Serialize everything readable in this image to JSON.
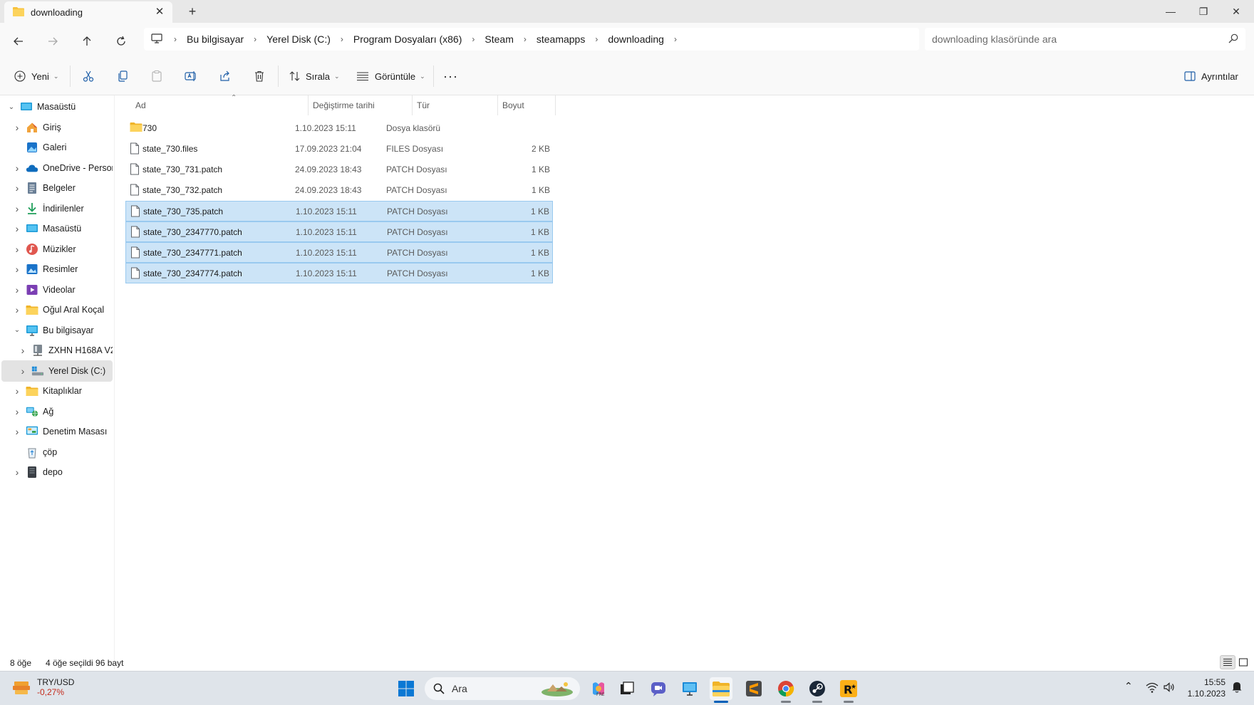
{
  "window": {
    "tab_title": "downloading",
    "new_tab": "+",
    "close_tab": "✕",
    "minimize": "—",
    "restore": "❐",
    "close": "✕"
  },
  "address": {
    "breadcrumbs": [
      "Bu bilgisayar",
      "Yerel Disk (C:)",
      "Program Dosyaları (x86)",
      "Steam",
      "steamapps",
      "downloading"
    ],
    "search_placeholder": "downloading klasöründe ara"
  },
  "toolbar": {
    "new_label": "Yeni",
    "sort_label": "Sırala",
    "view_label": "Görüntüle",
    "more_label": "···",
    "details_label": "Ayrıntılar"
  },
  "sidebar": {
    "items": [
      {
        "label": "Masaüstü",
        "icon": "desktop-icon",
        "expander": "open"
      },
      {
        "label": "Giriş",
        "icon": "home-icon",
        "expander": "closed"
      },
      {
        "label": "Galeri",
        "icon": "gallery-icon",
        "expander": "none"
      },
      {
        "label": "OneDrive - Person",
        "icon": "onedrive-icon",
        "expander": "closed"
      },
      {
        "label": "Belgeler",
        "icon": "documents-icon",
        "expander": "closed"
      },
      {
        "label": "İndirilenler",
        "icon": "downloads-icon",
        "expander": "closed"
      },
      {
        "label": "Masaüstü",
        "icon": "desktop-icon",
        "expander": "closed"
      },
      {
        "label": "Müzikler",
        "icon": "music-icon",
        "expander": "closed"
      },
      {
        "label": "Resimler",
        "icon": "pictures-icon",
        "expander": "closed"
      },
      {
        "label": "Videolar",
        "icon": "videos-icon",
        "expander": "closed"
      },
      {
        "label": "Oğul Aral Koçal",
        "icon": "folder-icon",
        "expander": "closed"
      },
      {
        "label": "Bu bilgisayar",
        "icon": "computer-icon",
        "expander": "open"
      },
      {
        "label": "ZXHN H168A V2",
        "icon": "network-drive-icon",
        "expander": "closed"
      },
      {
        "label": "Yerel Disk (C:)",
        "icon": "local-disk-icon",
        "expander": "closed"
      },
      {
        "label": "Kitaplıklar",
        "icon": "libraries-icon",
        "expander": "closed"
      },
      {
        "label": "Ağ",
        "icon": "network-icon",
        "expander": "closed"
      },
      {
        "label": "Denetim Masası",
        "icon": "control-panel-icon",
        "expander": "closed"
      },
      {
        "label": "çöp",
        "icon": "recycle-bin-icon",
        "expander": "none"
      },
      {
        "label": "depo",
        "icon": "storage-icon",
        "expander": "closed"
      }
    ],
    "selected_index": 13
  },
  "columns": {
    "name": "Ad",
    "date": "Değiştirme tarihi",
    "type": "Tür",
    "size": "Boyut"
  },
  "files": [
    {
      "name": "730",
      "date": "1.10.2023 15:11",
      "type": "Dosya klasörü",
      "size": "",
      "kind": "folder",
      "selected": false
    },
    {
      "name": "state_730.files",
      "date": "17.09.2023 21:04",
      "type": "FILES Dosyası",
      "size": "2 KB",
      "kind": "file",
      "selected": false
    },
    {
      "name": "state_730_731.patch",
      "date": "24.09.2023 18:43",
      "type": "PATCH Dosyası",
      "size": "1 KB",
      "kind": "file",
      "selected": false
    },
    {
      "name": "state_730_732.patch",
      "date": "24.09.2023 18:43",
      "type": "PATCH Dosyası",
      "size": "1 KB",
      "kind": "file",
      "selected": false
    },
    {
      "name": "state_730_735.patch",
      "date": "1.10.2023 15:11",
      "type": "PATCH Dosyası",
      "size": "1 KB",
      "kind": "file",
      "selected": true
    },
    {
      "name": "state_730_2347770.patch",
      "date": "1.10.2023 15:11",
      "type": "PATCH Dosyası",
      "size": "1 KB",
      "kind": "file",
      "selected": true
    },
    {
      "name": "state_730_2347771.patch",
      "date": "1.10.2023 15:11",
      "type": "PATCH Dosyası",
      "size": "1 KB",
      "kind": "file",
      "selected": true
    },
    {
      "name": "state_730_2347774.patch",
      "date": "1.10.2023 15:11",
      "type": "PATCH Dosyası",
      "size": "1 KB",
      "kind": "file",
      "selected": true
    }
  ],
  "status": {
    "item_count": "8 öğe",
    "selection": "4 öğe seçildi  96 bayt"
  },
  "taskbar": {
    "widget_title": "TRY/USD",
    "widget_value": "-0,27%",
    "search_label": "Ara",
    "clock_time": "15:55",
    "clock_date": "1.10.2023",
    "apps": [
      "start-icon",
      "search-icon",
      "copilot-icon",
      "task-view-icon",
      "chat-icon",
      "remote-desktop-icon",
      "file-explorer-icon",
      "sublime-text-icon",
      "chrome-icon",
      "steam-icon",
      "rockstar-icon"
    ]
  },
  "colors": {
    "selection_fill": "#cce4f7",
    "selection_border": "#99c9ef",
    "folder_yellow": "#f8c23c",
    "accent": "#005fb8",
    "negative": "#c42b1c"
  }
}
